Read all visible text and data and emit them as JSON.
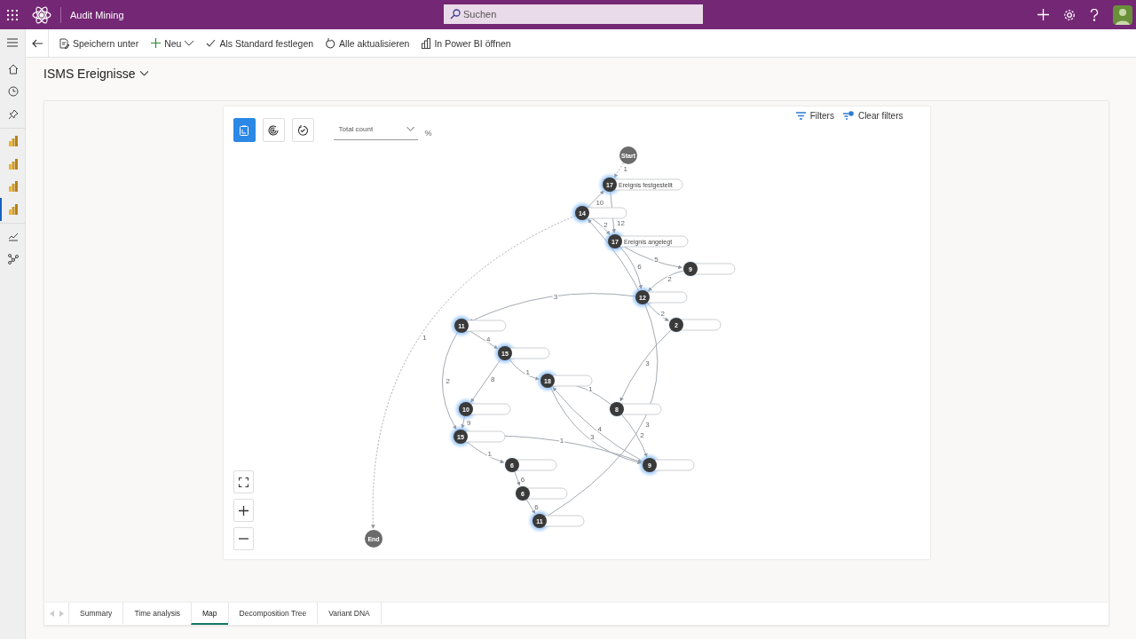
{
  "app": {
    "title": "Audit Mining",
    "search_placeholder": "Suchen"
  },
  "toolbar": [
    {
      "kind": "save",
      "label": "Speichern unter"
    },
    {
      "kind": "new",
      "label": "Neu"
    },
    {
      "kind": "check",
      "label": "Als Standard festlegen"
    },
    {
      "kind": "refresh",
      "label": "Alle aktualisieren"
    },
    {
      "kind": "powerbi",
      "label": "In Power BI öffnen"
    }
  ],
  "sidebar": [
    {
      "kind": "home",
      "selected": false
    },
    {
      "kind": "recent",
      "selected": false
    },
    {
      "kind": "pinned",
      "selected": false
    },
    {
      "kind": "report",
      "selected": false
    },
    {
      "kind": "report",
      "selected": false
    },
    {
      "kind": "report",
      "selected": false
    },
    {
      "kind": "report",
      "selected": true
    },
    {
      "kind": "analytics",
      "selected": false
    },
    {
      "kind": "network",
      "selected": false
    }
  ],
  "page_title": "ISMS Ereignisse",
  "map": {
    "view_buttons": [
      {
        "kind": "activity",
        "selected": true
      },
      {
        "kind": "target",
        "selected": false
      },
      {
        "kind": "cycle",
        "selected": false
      }
    ],
    "metric": "Total count",
    "unit": "%",
    "filters": "Filters",
    "clear_filters": "Clear filters",
    "nodes": [
      {
        "kind": "start",
        "label": "Start"
      },
      {
        "kind": "activity",
        "count": "17",
        "label": "Ereignis festgestellt",
        "highlighted": true
      },
      {
        "kind": "activity",
        "count": "14",
        "highlighted": true
      },
      {
        "kind": "activity",
        "count": "17",
        "label": "Ereignis angelegt",
        "highlighted": true
      },
      {
        "kind": "activity",
        "count": "9",
        "highlighted": false
      },
      {
        "kind": "activity",
        "count": "12",
        "highlighted": true
      },
      {
        "kind": "activity",
        "count": "2",
        "highlighted": false
      },
      {
        "kind": "activity",
        "count": "11",
        "highlighted": true
      },
      {
        "kind": "activity",
        "count": "15",
        "highlighted": true
      },
      {
        "kind": "activity",
        "count": "18",
        "highlighted": true
      },
      {
        "kind": "activity",
        "count": "10",
        "highlighted": true
      },
      {
        "kind": "activity",
        "count": "8",
        "highlighted": false
      },
      {
        "kind": "activity",
        "count": "15",
        "highlighted": true
      },
      {
        "kind": "activity",
        "count": "6",
        "highlighted": false
      },
      {
        "kind": "activity",
        "count": "9",
        "highlighted": true
      },
      {
        "kind": "activity",
        "count": "6",
        "highlighted": false
      },
      {
        "kind": "activity",
        "count": "11",
        "highlighted": true
      },
      {
        "kind": "end",
        "label": "End"
      }
    ],
    "edges": [
      {
        "label": "1",
        "dashed": true
      },
      {
        "label": "10",
        "dashed": false
      },
      {
        "label": "12",
        "dashed": false
      },
      {
        "label": "2",
        "dashed": false
      },
      {
        "label": "5",
        "dashed": false
      },
      {
        "label": "6",
        "dashed": false
      },
      {
        "label": "2",
        "dashed": false
      },
      {
        "label": "2",
        "dashed": false
      },
      {
        "label": "3",
        "dashed": false
      },
      {
        "label": "4",
        "dashed": false
      },
      {
        "label": "8",
        "dashed": false
      },
      {
        "label": "9",
        "dashed": false
      },
      {
        "label": "1",
        "dashed": false
      },
      {
        "label": "1",
        "dashed": false
      },
      {
        "label": "4",
        "dashed": false
      },
      {
        "label": "1",
        "dashed": false
      },
      {
        "label": "1",
        "dashed": false
      },
      {
        "label": "6",
        "dashed": false
      },
      {
        "label": "6",
        "dashed": false
      },
      {
        "label": "3",
        "dashed": false
      },
      {
        "label": "3",
        "dashed": false
      },
      {
        "label": "1",
        "dashed": true
      },
      {
        "label": "2",
        "dashed": false
      },
      {
        "label": "3",
        "dashed": false
      },
      {
        "label": "2",
        "dashed": false
      }
    ]
  },
  "tabs": [
    {
      "label": "Summary",
      "selected": false
    },
    {
      "label": "Time analysis",
      "selected": false
    },
    {
      "label": "Map",
      "selected": true
    },
    {
      "label": "Decomposition Tree",
      "selected": false
    },
    {
      "label": "Variant DNA",
      "selected": false
    }
  ]
}
